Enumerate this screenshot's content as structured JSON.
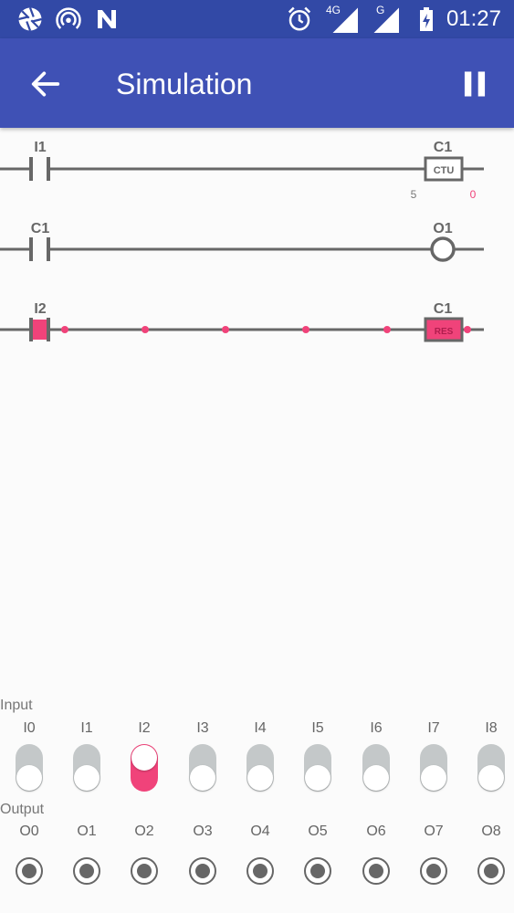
{
  "status_bar": {
    "time": "01:27",
    "network_4g_label": "4G",
    "network_g_label": "G",
    "icons": [
      "aperture-icon",
      "hotspot-icon",
      "n-logo-icon",
      "alarm-icon",
      "signal-4g-icon",
      "signal-g-icon",
      "battery-charging-icon"
    ]
  },
  "app_bar": {
    "title": "Simulation",
    "back_icon": "arrow-left-icon",
    "pause_icon": "pause-icon"
  },
  "colors": {
    "status_bar": "#3249a6",
    "app_bar": "#3f51b5",
    "active": "#f0437a",
    "rail": "#676767",
    "toggle_off": "#c4c8c9"
  },
  "ladder": {
    "rungs": [
      {
        "contact_label": "I1",
        "contact_active": false,
        "output_label": "C1",
        "output_type": "counter",
        "output_text": "CTU",
        "output_active": false,
        "preset": "5",
        "count": "0"
      },
      {
        "contact_label": "C1",
        "contact_active": false,
        "output_label": "O1",
        "output_type": "coil",
        "output_active": false
      },
      {
        "contact_label": "I2",
        "contact_active": true,
        "output_label": "C1",
        "output_type": "reset",
        "output_text": "RES",
        "output_active": true
      }
    ]
  },
  "io": {
    "input_label": "Input",
    "output_label": "Output",
    "inputs": [
      {
        "name": "I0",
        "on": false
      },
      {
        "name": "I1",
        "on": false
      },
      {
        "name": "I2",
        "on": true
      },
      {
        "name": "I3",
        "on": false
      },
      {
        "name": "I4",
        "on": false
      },
      {
        "name": "I5",
        "on": false
      },
      {
        "name": "I6",
        "on": false
      },
      {
        "name": "I7",
        "on": false
      },
      {
        "name": "I8",
        "on": false
      }
    ],
    "outputs": [
      {
        "name": "O0",
        "on": false
      },
      {
        "name": "O1",
        "on": false
      },
      {
        "name": "O2",
        "on": false
      },
      {
        "name": "O3",
        "on": false
      },
      {
        "name": "O4",
        "on": false
      },
      {
        "name": "O5",
        "on": false
      },
      {
        "name": "O6",
        "on": false
      },
      {
        "name": "O7",
        "on": false
      },
      {
        "name": "O8",
        "on": false
      }
    ]
  }
}
